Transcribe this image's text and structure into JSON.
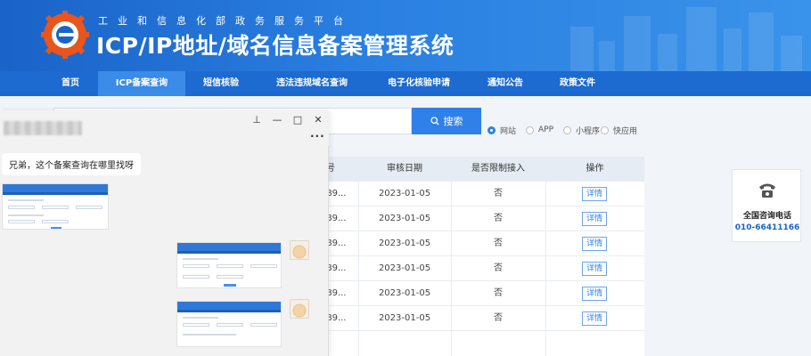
{
  "header": {
    "small_title": "工业和信息化部政务服务平台",
    "main_title": "ICP/IP地址/域名信息备案管理系统"
  },
  "nav": {
    "items": [
      {
        "label": "首页",
        "active": false
      },
      {
        "label": "ICP备案查询",
        "active": true
      },
      {
        "label": "短信核验",
        "active": false
      },
      {
        "label": "违法违规域名查询",
        "active": false
      },
      {
        "label": "电子化核验申请",
        "active": false
      },
      {
        "label": "通知公告",
        "active": false
      },
      {
        "label": "政策文件",
        "active": false
      }
    ]
  },
  "search": {
    "button_label": "搜索",
    "button_icon": "search-icon",
    "types": [
      {
        "label": "网站",
        "selected": true
      },
      {
        "label": "APP",
        "selected": false
      },
      {
        "label": "小程序",
        "selected": false
      },
      {
        "label": "快应用",
        "selected": false
      }
    ]
  },
  "table": {
    "headers": [
      "号",
      "审核日期",
      "是否限制接入",
      "操作"
    ],
    "rows": [
      {
        "number": "5789...",
        "date": "2023-01-05",
        "restricted": "否",
        "action": "详情"
      },
      {
        "number": "5789...",
        "date": "2023-01-05",
        "restricted": "否",
        "action": "详情"
      },
      {
        "number": "5789...",
        "date": "2023-01-05",
        "restricted": "否",
        "action": "详情"
      },
      {
        "number": "5789...",
        "date": "2023-01-05",
        "restricted": "否",
        "action": "详情"
      },
      {
        "number": "5789...",
        "date": "2023-01-05",
        "restricted": "否",
        "action": "详情"
      },
      {
        "number": "5789...",
        "date": "2023-01-05",
        "restricted": "否",
        "action": "详情"
      }
    ]
  },
  "contact": {
    "icon": "telephone-icon",
    "label": "全国咨询电话",
    "number": "010-66411166"
  },
  "chat": {
    "window_controls": [
      "pin-icon",
      "minimize-icon",
      "maximize-icon",
      "close-icon"
    ],
    "message": "兄弟，这个备案查询在哪里找呀"
  },
  "colors": {
    "brand_blue": "#1a63c8",
    "nav_active": "#3b8be8",
    "search_button": "#2f80e8"
  }
}
